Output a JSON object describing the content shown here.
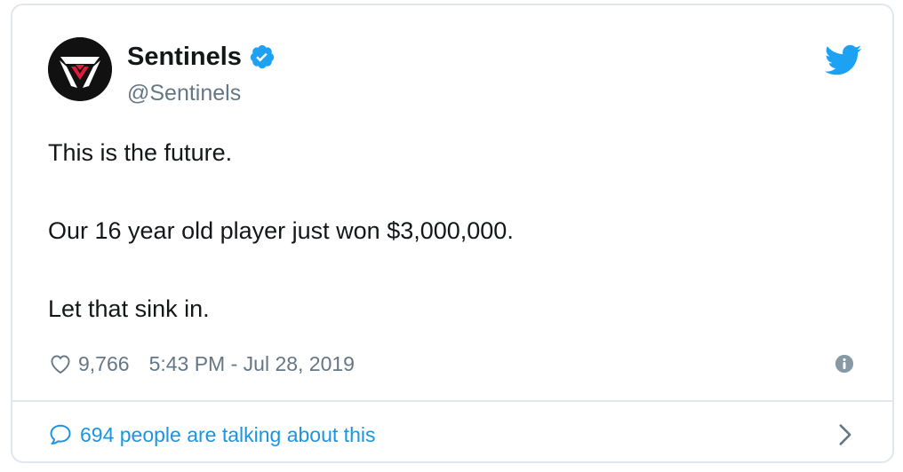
{
  "author": {
    "display_name": "Sentinels",
    "handle": "@Sentinels",
    "verified": true
  },
  "tweet": {
    "lines": [
      "This is the future.",
      "Our 16 year old player just won $3,000,000.",
      "Let that sink in."
    ]
  },
  "meta": {
    "likes": "9,766",
    "timestamp": "5:43 PM - Jul 28, 2019"
  },
  "footer": {
    "talking_label": "694 people are talking about this"
  },
  "icons": {
    "verified": "verified-badge-icon",
    "bird": "twitter-bird-icon",
    "heart": "heart-icon",
    "info": "info-icon",
    "bubble": "speech-bubble-icon",
    "chevron": "chevron-right-icon"
  },
  "colors": {
    "brand_blue": "#1da1f2",
    "link_blue": "#1b95e0",
    "text": "#14171a",
    "muted": "#657786",
    "border": "#e1e8ed",
    "logo_red": "#e31b3a"
  }
}
